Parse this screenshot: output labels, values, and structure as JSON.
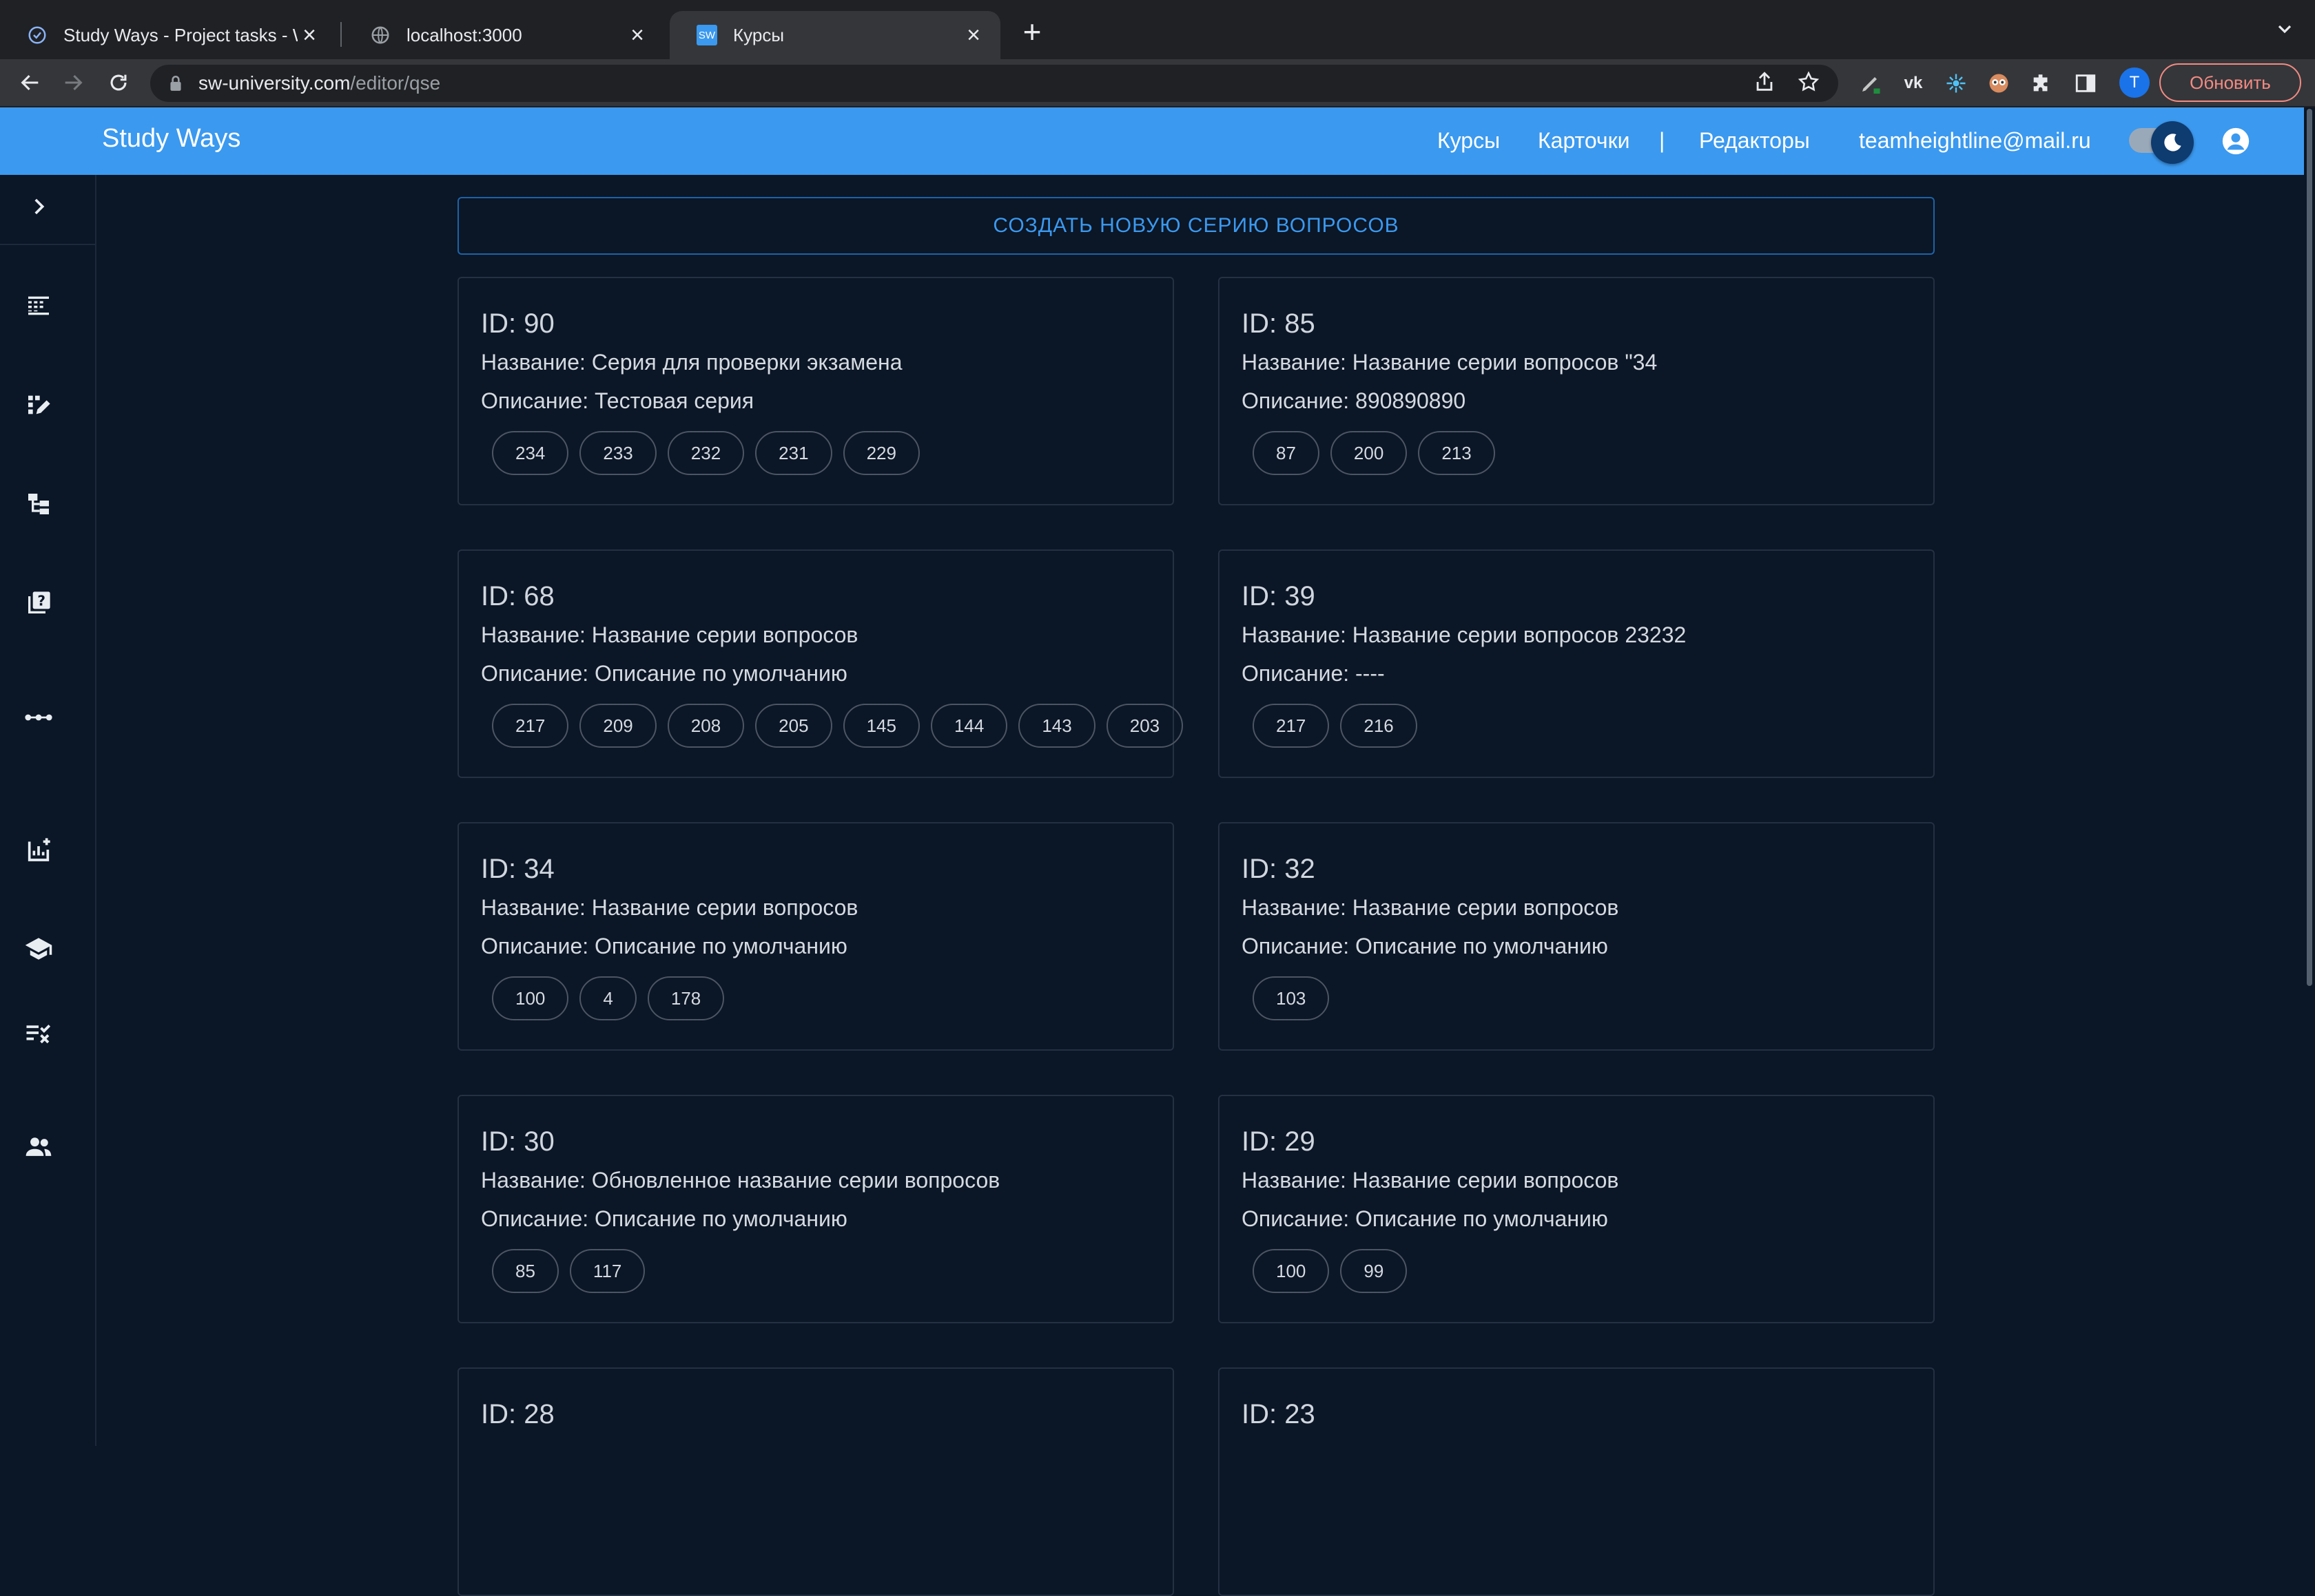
{
  "browser": {
    "tabs": [
      {
        "title": "Study Ways - Project tasks - W",
        "favicon": "check-circle-icon"
      },
      {
        "title": "localhost:3000",
        "favicon": "globe-icon"
      },
      {
        "title": "Курсы",
        "favicon": "sw-favicon",
        "favicon_text": "SW",
        "active": true
      }
    ],
    "url_host": "sw-university.com",
    "url_path": "/editor/qse",
    "update_label": "Обновить",
    "profile_initial": "T"
  },
  "header": {
    "brand": "Study Ways",
    "nav": {
      "courses": "Курсы",
      "cards": "Карточки",
      "separator": "|",
      "editors": "Редакторы",
      "email": "teamheightline@mail.ru"
    }
  },
  "sidebar": {
    "items": [
      "expand-icon",
      "table-icon",
      "edit-list-icon",
      "hierarchy-icon",
      "quiz-icon",
      "more-horiz-icon",
      "analytics-icon",
      "school-icon",
      "checklist-icon",
      "people-icon"
    ]
  },
  "main": {
    "create_label": "СОЗДАТЬ НОВУЮ СЕРИЮ ВОПРОСОВ",
    "series": [
      {
        "id": "ID: 90",
        "name": "Название: Серия для проверки экзамена",
        "description": "Описание: Тестовая серия",
        "questions": [
          "234",
          "233",
          "232",
          "231",
          "229"
        ]
      },
      {
        "id": "ID: 85",
        "name": "Название: Название серии вопросов \"34",
        "description": "Описание: 890890890",
        "questions": [
          "87",
          "200",
          "213"
        ]
      },
      {
        "id": "ID: 68",
        "name": "Название: Название серии вопросов",
        "description": "Описание: Описание по умолчанию",
        "questions": [
          "217",
          "209",
          "208",
          "205",
          "145",
          "144",
          "143",
          "203"
        ]
      },
      {
        "id": "ID: 39",
        "name": "Название: Название серии вопросов 23232",
        "description": "Описание: ----",
        "questions": [
          "217",
          "216"
        ]
      },
      {
        "id": "ID: 34",
        "name": "Название: Название серии вопросов",
        "description": "Описание: Описание по умолчанию",
        "questions": [
          "100",
          "4",
          "178"
        ]
      },
      {
        "id": "ID: 32",
        "name": "Название: Название серии вопросов",
        "description": "Описание: Описание по умолчанию",
        "questions": [
          "103"
        ]
      },
      {
        "id": "ID: 30",
        "name": "Название: Обновленное название серии вопросов",
        "description": "Описание: Описание по умолчанию",
        "questions": [
          "85",
          "117"
        ]
      },
      {
        "id": "ID: 29",
        "name": "Название: Название серии вопросов",
        "description": "Описание: Описание по умолчанию",
        "questions": [
          "100",
          "99"
        ]
      },
      {
        "id": "ID: 28"
      },
      {
        "id": "ID: 23"
      }
    ]
  },
  "colors": {
    "header_bg": "#3b99ef",
    "page_bg": "#0b1626",
    "accent": "#3b99ef",
    "card_border": "#243143"
  }
}
